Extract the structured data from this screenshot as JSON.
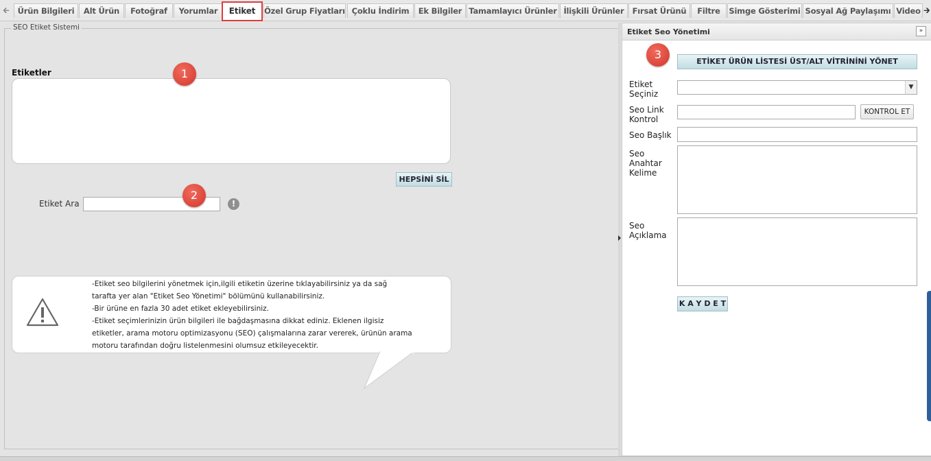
{
  "tabs": [
    {
      "label": "Ürün Bilgileri",
      "active": false
    },
    {
      "label": "Alt Ürün",
      "active": false
    },
    {
      "label": "Fotoğraf",
      "active": false
    },
    {
      "label": "Yorumlar",
      "active": false
    },
    {
      "label": "Etiket",
      "active": true
    },
    {
      "label": "Özel Grup Fiyatları",
      "active": false
    },
    {
      "label": "Çoklu İndirim",
      "active": false
    },
    {
      "label": "Ek Bilgiler",
      "active": false
    },
    {
      "label": "Tamamlayıcı Ürünler",
      "active": false
    },
    {
      "label": "İlişkili Ürünler",
      "active": false
    },
    {
      "label": "Fırsat Ürünü",
      "active": false
    },
    {
      "label": "Filtre",
      "active": false
    },
    {
      "label": "Simge Gösterimi",
      "active": false
    },
    {
      "label": "Sosyal Ağ Paylaşımı",
      "active": false
    },
    {
      "label": "Video",
      "active": false
    }
  ],
  "left": {
    "legend": "SEO Etiket Sistemi",
    "tags_label": "Etiketler",
    "delete_all": "HEPSİNİ SİL",
    "search_label": "Etiket Ara",
    "search_value": "",
    "info_lines": [
      "-Etiket seo bilgilerini yönetmek için,ilgili etiketin üzerine tıklayabilirsiniz ya da sağ",
      "tarafta yer alan \"Etiket Seo Yönetimi\" bölümünü kullanabilirsiniz.",
      "-Bir ürüne en fazla 30 adet etiket ekleyebilirsiniz.",
      "-Etiket seçimlerinizin ürün bilgileri ile bağdaşmasına dikkat ediniz. Eklenen ilgisiz",
      "etiketler, arama motoru optimizasyonu (SEO) çalışmalarına zarar vererek, ürünün arama",
      "motoru tarafından doğru listelenmesini olumsuz etkileyecektir."
    ]
  },
  "badges": [
    "1",
    "2",
    "3"
  ],
  "right": {
    "title": "Etiket Seo Yönetimi",
    "collapse_glyph": "»",
    "manage_button": "ETİKET ÜRÜN LİSTESİ ÜST/ALT VİTRİNİNİ YÖNET",
    "select_label": "Etiket Seçiniz",
    "select_value": "",
    "link_label": "Seo Link Kontrol",
    "link_value": "",
    "check_button": "KONTROL ET",
    "title_label": "Seo Başlık",
    "title_value": "",
    "keywords_label": "Seo Anahtar Kelime",
    "keywords_value": "",
    "desc_label": "Seo Açıklama",
    "desc_value": "",
    "save_button": "K A Y D E T"
  },
  "colors": {
    "badge": "#d9392d",
    "active_tab_border": "#e03b3b",
    "button_teal": "#c2dde3",
    "right_rail": "#2f5f9b"
  }
}
